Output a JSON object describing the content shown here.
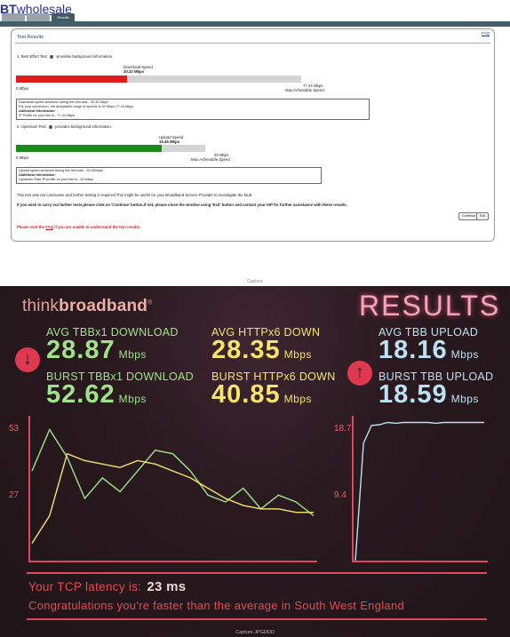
{
  "bt": {
    "logo_bold": "BT",
    "logo_rest": "wholesale",
    "tabs": [
      "",
      "",
      "Results"
    ],
    "title": "Test Results",
    "faq": "FAQ",
    "test1_label": "1. Best Effort Test:",
    "test_info": "-provides background information.",
    "download_speed_label": "Download Speed",
    "download_speed_value": "30.32 Mbps",
    "zero_mbps": "0 Mbps",
    "max_down": "77.44 Mbps",
    "max_achievable": "Max Achievable Speed",
    "download_box": {
      "line1": "Download speed achieved during the test was - 30.32 Mbps",
      "line2": "For your connection, the acceptable range of speeds is 40 Mbps-77.44 Mbps",
      "line3": "Additional Information:",
      "line4": "IP Profile for your line is - 77.44 Mbps"
    },
    "test2_label": "2. Upstream Test:",
    "upload_speed_label": "Upload Speed",
    "upload_speed_value": "15.45 Mbps",
    "max_up": "20 Mbps",
    "upload_box": {
      "line1": "Upload speed achieved during the test was - 15.45Mbps",
      "line2": "Additional Information:",
      "line3": "Upstream Rate IP profile on your line is - 20 Mbps"
    },
    "conclusion": "This test was not conclusive and further testing is required.This might be useful for your Broadband Service Provider to investigate the fault.",
    "instructions": "If you wish to carry out further tests,please click on 'Continue' button.If not, please close the window using 'Exit' button and contact your ISP for further assistance with these results.",
    "continue_label": "Continue",
    "exit_label": "Exit",
    "visit_pre": "Please visit the ",
    "visit_link": "FAQ",
    "visit_post": " if you are unable to understand the test results.",
    "colors": {
      "download_bar": "#e01c1c",
      "upload_bar": "#1a8a1a"
    },
    "download_fraction": 0.39,
    "upload_fraction": 0.77,
    "caption": "Capture"
  },
  "tb": {
    "logo_light": "think",
    "logo_bold": "broadband",
    "logo_reg": "®",
    "results_title": "RESULTS",
    "avg_tbb_down_label": "AVG TBBx1 DOWNLOAD",
    "avg_tbb_down_value": "28.87",
    "burst_tbb_down_label": "BURST TBBx1 DOWNLOAD",
    "burst_tbb_down_value": "52.62",
    "avg_http_down_label": "AVG HTTPx6 DOWN",
    "avg_http_down_value": "28.35",
    "burst_http_down_label": "BURST HTTPx6 DOWN",
    "burst_http_down_value": "40.85",
    "avg_tbb_up_label": "AVG TBB UPLOAD",
    "avg_tbb_up_value": "18.16",
    "burst_tbb_up_label": "BURST TBB UPLOAD",
    "burst_tbb_up_value": "18.59",
    "unit": "Mbps",
    "down_icon": "arrow-down-icon",
    "up_icon": "arrow-up-icon",
    "latency_label": "Your TCP latency is:",
    "latency_value": "23 ms",
    "congrats": "Congratulations you're faster than the average in South West England",
    "caption": "Capture.JPGDDD",
    "colors": {
      "green": "#9fe48b",
      "yellow": "#f6e36e",
      "blue": "#bde1f2",
      "accent": "#d94b5c"
    }
  },
  "chart_data": [
    {
      "type": "line",
      "title": "",
      "y_tick_labels": [
        "53",
        "27"
      ],
      "ylim": [
        14,
        56
      ],
      "series": [
        {
          "color": "#9fe48b",
          "values": [
            40,
            52,
            44,
            32,
            38,
            34,
            40,
            46,
            45,
            40,
            33,
            31,
            35,
            29,
            33,
            31,
            27
          ]
        },
        {
          "color": "#f6e36e",
          "values": [
            19,
            27,
            45,
            43,
            42,
            41,
            43,
            42,
            40,
            38,
            35,
            32,
            30,
            29,
            29,
            28,
            28
          ]
        }
      ]
    },
    {
      "type": "line",
      "title": "",
      "y_tick_labels": [
        "18.7",
        "9.4"
      ],
      "ylim": [
        0,
        19.5
      ],
      "series": [
        {
          "color": "#bde1f2",
          "values": [
            0,
            15.8,
            18.2,
            18.3,
            18.6,
            18.5,
            18.6,
            18.6,
            18.6,
            18.6,
            18.5,
            18.6,
            18.6,
            18.6,
            18.6,
            18.6,
            18.6
          ]
        }
      ]
    }
  ]
}
